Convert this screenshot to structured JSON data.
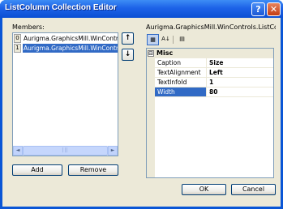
{
  "window": {
    "title": "ListColumn Collection Editor",
    "help_glyph": "?",
    "close_glyph": "✕"
  },
  "members": {
    "label": "Members:",
    "items": [
      {
        "index": "0",
        "text": "Aurigma.GraphicsMill.WinControls."
      },
      {
        "index": "1",
        "text": "Aurigma.GraphicsMill.WinControls."
      }
    ],
    "selected_index": 1,
    "scroll_left": "◄",
    "scroll_right": "►",
    "scroll_grip": "|||"
  },
  "reorder": {
    "up_glyph": "↑",
    "down_glyph": "↓"
  },
  "buttons": {
    "add": "Add",
    "remove": "Remove",
    "ok": "OK",
    "cancel": "Cancel"
  },
  "properties": {
    "header": "Aurigma.GraphicsMill.WinControls.ListColu...",
    "toolbar": {
      "categorized_icon": "▦",
      "alphabetical_icon": "A↓",
      "pages_icon": "▤"
    },
    "category": {
      "toggle": "⊟",
      "name": "Misc"
    },
    "rows": [
      {
        "name": "Caption",
        "value": "Size"
      },
      {
        "name": "TextAlignment",
        "value": "Left"
      },
      {
        "name": "TextInfoId",
        "value": "1"
      },
      {
        "name": "Width",
        "value": "80"
      }
    ],
    "selected_row": 3
  },
  "colors": {
    "title_bar": "#0a56d6",
    "selection": "#316ac5",
    "dialog_bg": "#ece9d8"
  }
}
